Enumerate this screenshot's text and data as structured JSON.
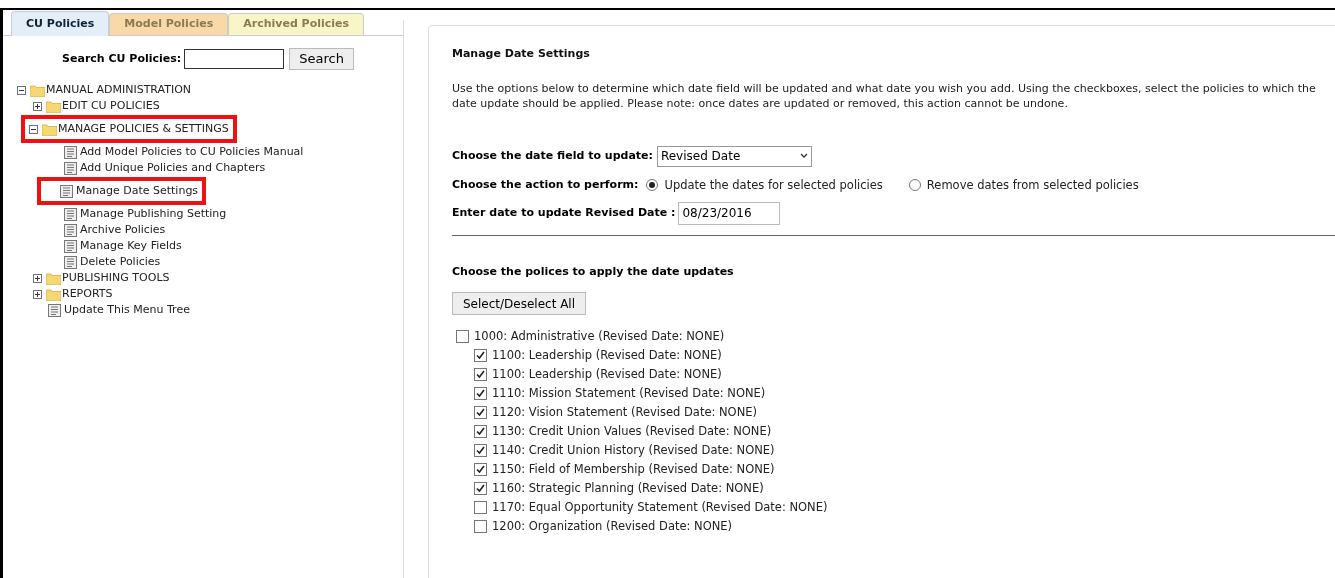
{
  "tabs": [
    {
      "label": "CU Policies",
      "selected": true,
      "color": "#e3eef8"
    },
    {
      "label": "Model Policies",
      "selected": false,
      "color": "#f9d9a8"
    },
    {
      "label": "Archived Policies",
      "selected": false,
      "color": "#f8f6c8"
    }
  ],
  "search": {
    "label": "Search CU Policies:",
    "button": "Search"
  },
  "tree": [
    {
      "label": "MANUAL ADMINISTRATION",
      "kind": "folder",
      "expanded": true,
      "highlighted": false,
      "children": [
        {
          "label": "EDIT CU POLICIES",
          "kind": "folder",
          "expanded": false,
          "highlighted": false
        },
        {
          "label": "MANAGE POLICIES & SETTINGS",
          "kind": "folder",
          "expanded": true,
          "highlighted": true,
          "children": [
            {
              "label": "Add Model Policies to CU Policies Manual",
              "kind": "page",
              "highlighted": false
            },
            {
              "label": "Add Unique Policies and Chapters",
              "kind": "page",
              "highlighted": false
            },
            {
              "label": "Manage Date Settings",
              "kind": "page",
              "highlighted": true
            },
            {
              "label": "Manage Publishing Setting",
              "kind": "page",
              "highlighted": false
            },
            {
              "label": "Archive Policies",
              "kind": "page",
              "highlighted": false
            },
            {
              "label": "Manage Key Fields",
              "kind": "page",
              "highlighted": false
            },
            {
              "label": "Delete Policies",
              "kind": "page",
              "highlighted": false
            }
          ]
        },
        {
          "label": "PUBLISHING TOOLS",
          "kind": "folder",
          "expanded": false,
          "highlighted": false
        },
        {
          "label": "REPORTS",
          "kind": "folder",
          "expanded": false,
          "highlighted": false
        },
        {
          "label": "Update This Menu Tree",
          "kind": "page",
          "highlighted": false
        }
      ]
    }
  ],
  "panel": {
    "title": "Manage Date Settings",
    "intro": "Use the options below to determine which date field will be updated and what date you wish you add. Using the checkboxes, select the policies to which the date update should be applied. Please note: once dates are updated or removed, this action cannot be undone.",
    "date_field": {
      "label": "Choose the date field to update:",
      "value": "Revised Date"
    },
    "action": {
      "label": "Choose the action to perform:",
      "options": [
        {
          "label": "Update the dates for selected policies",
          "selected": true
        },
        {
          "label": "Remove dates from selected policies",
          "selected": false
        }
      ]
    },
    "date_input": {
      "label": "Enter date to update Revised Date :",
      "value": "08/23/2016"
    },
    "policies_heading": "Choose the polices to apply the date updates",
    "select_all": "Select/Deselect All",
    "policies": [
      {
        "label": "1000: Administrative (Revised Date: NONE)",
        "checked": false,
        "children": [
          {
            "label": "1100: Leadership (Revised Date: NONE)",
            "checked": true
          },
          {
            "label": "1100: Leadership (Revised Date: NONE)",
            "checked": true
          },
          {
            "label": "1110: Mission Statement (Revised Date: NONE)",
            "checked": true
          },
          {
            "label": "1120: Vision Statement (Revised Date: NONE)",
            "checked": true
          },
          {
            "label": "1130: Credit Union Values (Revised Date: NONE)",
            "checked": true
          },
          {
            "label": "1140: Credit Union History (Revised Date: NONE)",
            "checked": true
          },
          {
            "label": "1150: Field of Membership (Revised Date: NONE)",
            "checked": true
          },
          {
            "label": "1160: Strategic Planning (Revised Date: NONE)",
            "checked": true
          },
          {
            "label": "1170: Equal Opportunity Statement (Revised Date: NONE)",
            "checked": false
          },
          {
            "label": "1200: Organization (Revised Date: NONE)",
            "checked": false
          }
        ]
      }
    ]
  }
}
